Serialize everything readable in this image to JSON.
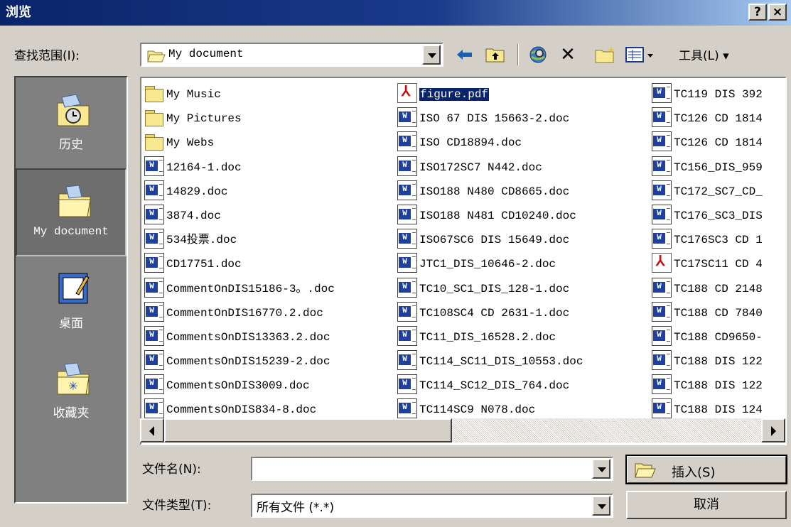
{
  "window": {
    "title": "浏览",
    "help_button": "?",
    "close_button": "×"
  },
  "lookin": {
    "label": "查找范围(I):",
    "value": "My document"
  },
  "toolbar": {
    "back_icon": "back-arrow-icon",
    "up_icon": "up-folder-icon",
    "search_icon": "search-web-icon",
    "delete_icon": "delete-x-icon",
    "new_folder_icon": "new-folder-icon",
    "views_icon": "views-icon",
    "tools_label": "工具(L) ▾"
  },
  "places": [
    {
      "label": "历史",
      "icon": "history-icon"
    },
    {
      "label": "My document",
      "icon": "my-documents-icon"
    },
    {
      "label": "桌面",
      "icon": "desktop-icon"
    },
    {
      "label": "收藏夹",
      "icon": "favorites-icon"
    }
  ],
  "files": {
    "col1": [
      {
        "name": "My Music",
        "type": "folder"
      },
      {
        "name": "My Pictures",
        "type": "folder"
      },
      {
        "name": "My Webs",
        "type": "folder"
      },
      {
        "name": "12164-1.doc",
        "type": "doc"
      },
      {
        "name": "14829.doc",
        "type": "doc"
      },
      {
        "name": "3874.doc",
        "type": "doc"
      },
      {
        "name": "534投票.doc",
        "type": "doc"
      },
      {
        "name": "CD17751.doc",
        "type": "doc"
      },
      {
        "name": "CommentOnDIS15186-3。.doc",
        "type": "doc"
      },
      {
        "name": "CommentOnDIS16770.2.doc",
        "type": "doc"
      },
      {
        "name": "CommentsOnDIS13363.2.doc",
        "type": "doc"
      },
      {
        "name": "CommentsOnDIS15239-2.doc",
        "type": "doc"
      },
      {
        "name": "CommentsOnDIS3009.doc",
        "type": "doc"
      },
      {
        "name": "CommentsOnDIS834-8.doc",
        "type": "doc"
      }
    ],
    "col2": [
      {
        "name": "figure.pdf",
        "type": "pdf",
        "selected": true
      },
      {
        "name": "ISO 67 DIS 15663-2.doc",
        "type": "doc"
      },
      {
        "name": "ISO CD18894.doc",
        "type": "doc"
      },
      {
        "name": "ISO172SC7 N442.doc",
        "type": "doc"
      },
      {
        "name": "ISO188 N480 CD8665.doc",
        "type": "doc"
      },
      {
        "name": "ISO188 N481 CD10240.doc",
        "type": "doc"
      },
      {
        "name": "ISO67SC6 DIS 15649.doc",
        "type": "doc"
      },
      {
        "name": "JTC1_DIS_10646-2.doc",
        "type": "doc"
      },
      {
        "name": "TC10_SC1_DIS_128-1.doc",
        "type": "doc"
      },
      {
        "name": "TC108SC4 CD 2631-1.doc",
        "type": "doc"
      },
      {
        "name": "TC11_DIS_16528.2.doc",
        "type": "doc"
      },
      {
        "name": "TC114_SC11_DIS_10553.doc",
        "type": "doc"
      },
      {
        "name": "TC114_SC12_DIS_764.doc",
        "type": "doc"
      },
      {
        "name": "TC114SC9 N078.doc",
        "type": "doc"
      }
    ],
    "col3": [
      {
        "name": "TC119 DIS 392",
        "type": "doc"
      },
      {
        "name": "TC126 CD 1814",
        "type": "doc"
      },
      {
        "name": "TC126 CD 1814",
        "type": "doc"
      },
      {
        "name": "TC156_DIS_959",
        "type": "doc"
      },
      {
        "name": "TC172_SC7_CD_",
        "type": "doc"
      },
      {
        "name": "TC176_SC3_DIS",
        "type": "doc"
      },
      {
        "name": "TC176SC3 CD 1",
        "type": "doc"
      },
      {
        "name": "TC17SC11 CD 4",
        "type": "pdf"
      },
      {
        "name": "TC188 CD 2148",
        "type": "doc"
      },
      {
        "name": "TC188 CD 7840",
        "type": "doc"
      },
      {
        "name": "TC188 CD9650-",
        "type": "doc"
      },
      {
        "name": "TC188 DIS 122",
        "type": "doc"
      },
      {
        "name": "TC188 DIS 122",
        "type": "doc"
      },
      {
        "name": "TC188 DIS 124",
        "type": "doc"
      }
    ]
  },
  "filename": {
    "label": "文件名(N):",
    "value": ""
  },
  "filetype": {
    "label": "文件类型(T):",
    "value": "所有文件 (*.*)"
  },
  "buttons": {
    "insert": "插入(S)",
    "cancel": "取消"
  }
}
